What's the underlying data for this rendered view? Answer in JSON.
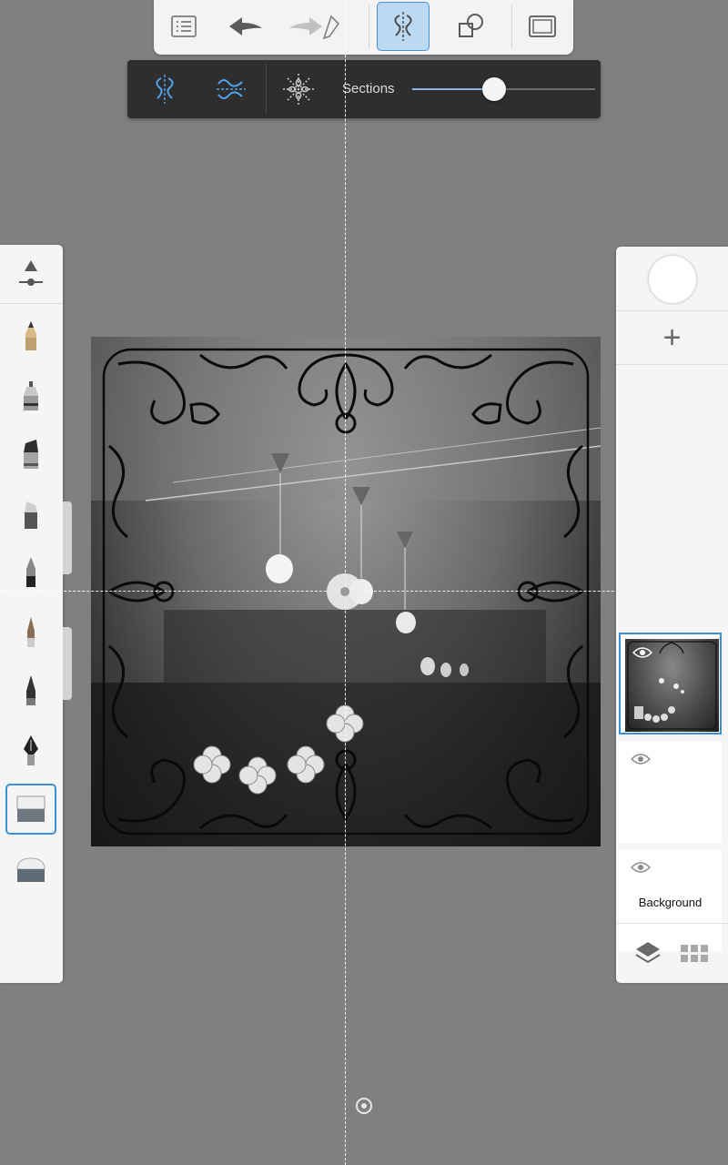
{
  "top_toolbar": {
    "buttons": [
      {
        "name": "menu-list-icon"
      },
      {
        "name": "undo-icon"
      },
      {
        "name": "redo-icon"
      },
      {
        "name": "ruler-pencil-icon"
      },
      {
        "name": "symmetry-icon",
        "active": true
      },
      {
        "name": "shapes-icon"
      },
      {
        "name": "fullscreen-icon"
      }
    ]
  },
  "symmetry_toolbar": {
    "modes": [
      "symmetry-vertical-icon",
      "symmetry-horizontal-icon",
      "symmetry-radial-icon"
    ],
    "sections_label": "Sections",
    "sections_value": 0.45
  },
  "brush_palette": {
    "top_icon": "brush-settings-icon",
    "brushes": [
      "pencil",
      "fineliner",
      "marker",
      "chisel-marker",
      "ballpoint-pen",
      "airbrush",
      "calligraphy-pen",
      "fountain-pen",
      "eraser",
      "soft-eraser"
    ],
    "active_brush": "eraser"
  },
  "layers": {
    "items": [
      {
        "label": "",
        "visible": true,
        "active": true
      },
      {
        "label": "",
        "visible": true,
        "active": false
      },
      {
        "label": "Background",
        "visible": true,
        "active": false
      }
    ],
    "add_label": "+"
  },
  "colors": {
    "accent": "#3d8fdc",
    "toolbar_bg": "#f3f3f3",
    "sym_toolbar_bg": "#2e2e2e",
    "workspace_bg": "#808080"
  }
}
